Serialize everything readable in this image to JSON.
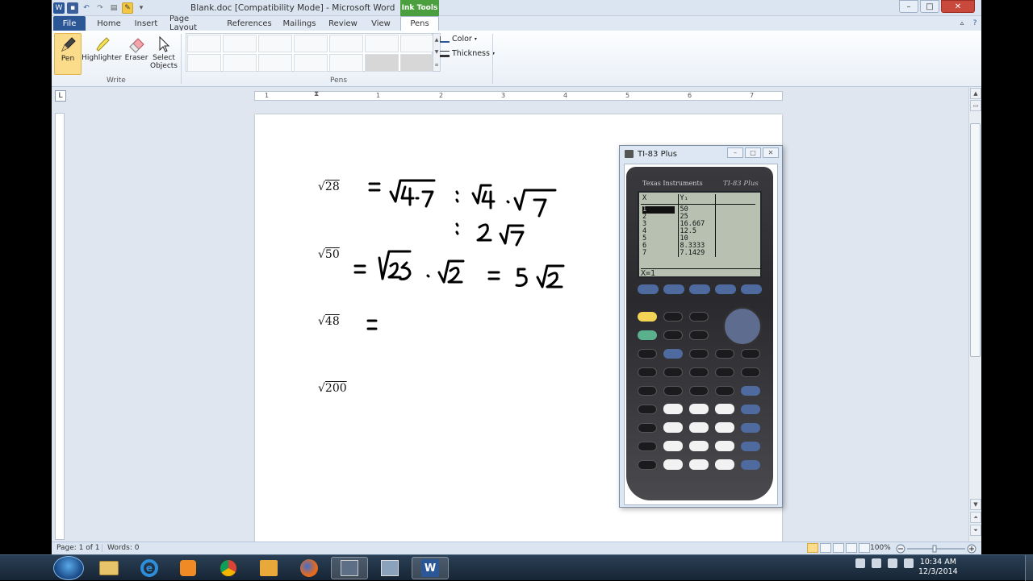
{
  "window": {
    "title": "Blank.doc [Compatibility Mode]  -  Microsoft Word",
    "context_tab": "Ink Tools",
    "controls": {
      "minimize": "–",
      "maximize": "□",
      "close": "✕"
    }
  },
  "tabs": [
    "File",
    "Home",
    "Insert",
    "Page Layout",
    "References",
    "Mailings",
    "Review",
    "View",
    "Pens"
  ],
  "active_tab": "Pens",
  "ribbon": {
    "write_group": {
      "label": "Write",
      "buttons": [
        {
          "label": "Pen",
          "icon": "pen-icon",
          "selected": true
        },
        {
          "label": "Highlighter",
          "icon": "highlighter-icon"
        },
        {
          "label": "Eraser",
          "icon": "eraser-icon"
        },
        {
          "label": "Select Objects",
          "icon": "cursor-icon"
        }
      ]
    },
    "pens_group": {
      "label": "Pens",
      "color_label": "Color",
      "thickness_label": "Thickness"
    }
  },
  "ruler": {
    "numbers": [
      "1",
      "1",
      "2",
      "3",
      "4",
      "5",
      "6",
      "7"
    ]
  },
  "document": {
    "expressions": [
      "28",
      "50",
      "48",
      "200"
    ]
  },
  "status": {
    "page": "Page: 1 of 1",
    "words": "Words: 0",
    "zoom": "100%"
  },
  "calculator": {
    "window_title": "TI-83 Plus",
    "brand": "Texas Instruments",
    "model": "TI-83 Plus",
    "table": {
      "headers": [
        "X",
        "Y₁",
        ""
      ],
      "x": [
        "1",
        "2",
        "3",
        "4",
        "5",
        "6",
        "7"
      ],
      "y": [
        "50",
        "25",
        "16.667",
        "12.5",
        "10",
        "8.3333",
        "7.1429"
      ]
    },
    "status_line": "X=1"
  },
  "taskbar": {
    "apps": [
      "windows-explorer",
      "internet-explorer",
      "media-player",
      "chrome",
      "outlook",
      "firefox",
      "ti-connect",
      "network",
      "word"
    ],
    "time": "10:34 AM",
    "date": "12/3/2014"
  },
  "colors": {
    "file_tab": "#2b5797",
    "ink_tools": "#4c9f3f",
    "ink": "#000000"
  }
}
